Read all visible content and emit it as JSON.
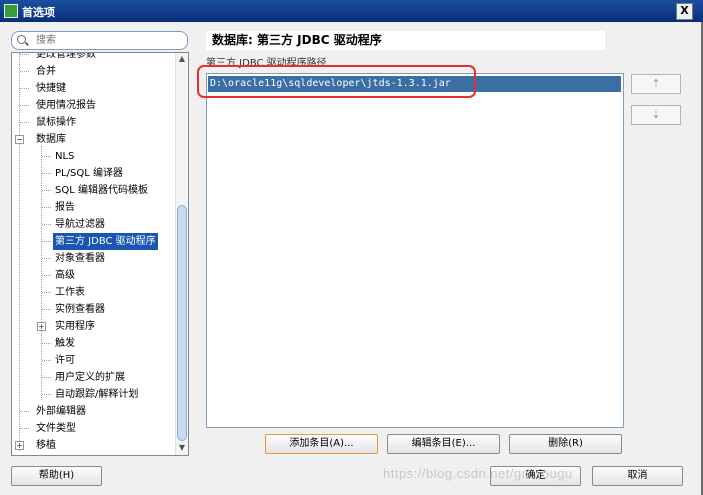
{
  "window": {
    "title": "首选项",
    "close_glyph": "X"
  },
  "search": {
    "placeholder": "搜索"
  },
  "tree": {
    "items": [
      {
        "label": "更改管理参数"
      },
      {
        "label": "合并"
      },
      {
        "label": "快捷键"
      },
      {
        "label": "使用情况报告"
      },
      {
        "label": "鼠标操作"
      },
      {
        "label": "数据库",
        "expanded": true
      },
      {
        "label": "NLS"
      },
      {
        "label": "PL/SQL 编译器"
      },
      {
        "label": "SQL 编辑器代码模板"
      },
      {
        "label": "报告"
      },
      {
        "label": "导航过滤器"
      },
      {
        "label": "第三方 JDBC 驱动程序",
        "selected": true
      },
      {
        "label": "对象查看器"
      },
      {
        "label": "高级"
      },
      {
        "label": "工作表"
      },
      {
        "label": "实例查看器"
      },
      {
        "label": "实用程序",
        "collapsed": true
      },
      {
        "label": "触发"
      },
      {
        "label": "许可"
      },
      {
        "label": "用户定义的扩展"
      },
      {
        "label": "自动跟踪/解释计划"
      },
      {
        "label": "外部编辑器"
      },
      {
        "label": "文件类型"
      },
      {
        "label": "移植",
        "collapsed": true
      }
    ],
    "expand_glyph": "+",
    "collapse_glyph": "−"
  },
  "panel": {
    "title": "数据库: 第三方 JDBC 驱动程序",
    "list_caption": "第三方 JDBC 驱动程序路径",
    "paths": [
      "D:\\oracle11g\\sqldeveloper\\jtds-1.3.1.jar"
    ]
  },
  "side_buttons": {
    "move_up": "⇡",
    "move_down": "⇣"
  },
  "buttons": {
    "add": "添加条目(A)...",
    "edit": "编辑条目(E)...",
    "delete": "删除(R)",
    "help": "帮助(H)",
    "ok": "确定",
    "cancel": "取消"
  },
  "watermark": "https://blog.csdn.net/gn...ougu",
  "colors": {
    "selection": "#3a6ea5",
    "highlight_box": "#e53030",
    "titlebar": "#0b2d7a"
  }
}
